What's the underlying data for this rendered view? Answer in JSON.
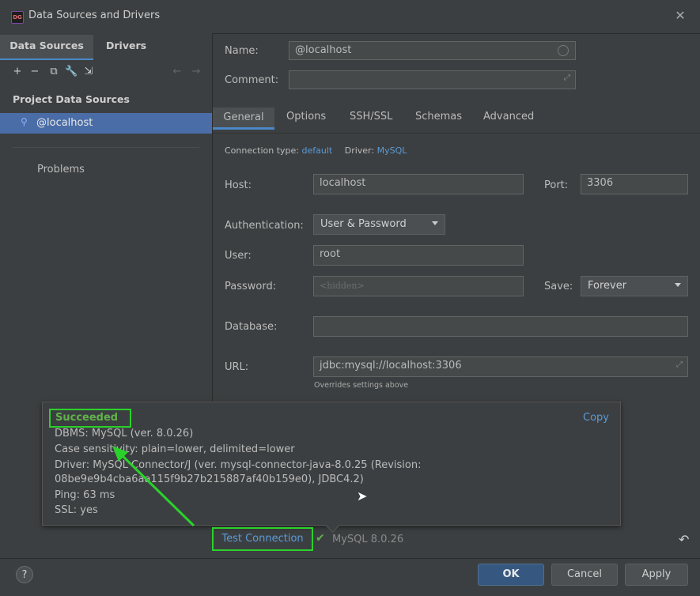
{
  "window": {
    "title": "Data Sources and Drivers",
    "app_icon": "DG"
  },
  "left": {
    "tabs": [
      "Data Sources",
      "Drivers"
    ],
    "section": "Project Data Sources",
    "selected": "@localhost",
    "problems": "Problems"
  },
  "form": {
    "name_label": "Name:",
    "name_value": "@localhost",
    "comment_label": "Comment:",
    "tabs": [
      "General",
      "Options",
      "SSH/SSL",
      "Schemas",
      "Advanced"
    ],
    "conn_type_label": "Connection type:",
    "conn_type_value": "default",
    "driver_label": "Driver:",
    "driver_value": "MySQL",
    "host_label": "Host:",
    "host_value": "localhost",
    "port_label": "Port:",
    "port_value": "3306",
    "auth_label": "Authentication:",
    "auth_value": "User & Password",
    "user_label": "User:",
    "user_value": "root",
    "password_label": "Password:",
    "password_placeholder": "<hidden>",
    "save_label": "Save:",
    "save_value": "Forever",
    "database_label": "Database:",
    "url_label": "URL:",
    "url_value": "jdbc:mysql://localhost:3306",
    "url_note": "Overrides settings above"
  },
  "popup": {
    "status": "Succeeded",
    "copy": "Copy",
    "lines": [
      "DBMS: MySQL (ver. 8.0.26)",
      "Case sensitivity: plain=lower, delimited=lower",
      "Driver: MySQL Connector/J (ver. mysql-connector-java-8.0.25 (Revision:",
      "08be9e9b4cba6aa115f9b27b215887af40b159e0), JDBC4.2)",
      "Ping: 63 ms",
      "SSL: yes"
    ]
  },
  "bottom": {
    "test_connection": "Test Connection",
    "version": "MySQL 8.0.26",
    "help": "?",
    "ok": "OK",
    "cancel": "Cancel",
    "apply": "Apply"
  },
  "colors": {
    "highlight": "#2bd12b",
    "link": "#5a9bd8",
    "selected_row": "#4a6da7"
  }
}
